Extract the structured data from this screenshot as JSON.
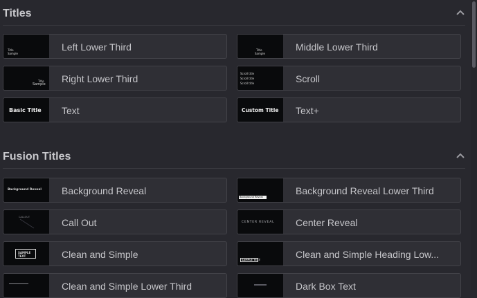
{
  "sections": [
    {
      "title": "Titles",
      "items": [
        {
          "label": "Left Lower Third",
          "thumb": [
            "Title",
            "Sample"
          ]
        },
        {
          "label": "Middle Lower Third",
          "thumb": [
            "Title",
            "Sample"
          ]
        },
        {
          "label": "Right Lower Third",
          "thumb": [
            "Title",
            "Sample"
          ]
        },
        {
          "label": "Scroll",
          "thumb": [
            "Scroll title",
            "Scroll title",
            "Scroll title"
          ]
        },
        {
          "label": "Text",
          "thumb": [
            "Basic Title"
          ]
        },
        {
          "label": "Text+",
          "thumb": [
            "Custom Title"
          ]
        }
      ]
    },
    {
      "title": "Fusion Titles",
      "items": [
        {
          "label": "Background Reveal",
          "thumb": [
            "Background Reveal"
          ]
        },
        {
          "label": "Background Reveal Lower Third",
          "thumb": [
            "Background Reveal"
          ]
        },
        {
          "label": "Call Out",
          "thumb": [
            "CALLOUT"
          ]
        },
        {
          "label": "Center Reveal",
          "thumb": [
            "CENTER REVEAL"
          ]
        },
        {
          "label": "Clean and Simple",
          "thumb": [
            "SAMPLE",
            "TEXT"
          ]
        },
        {
          "label": "Clean and Simple Heading Low...",
          "thumb": [
            "SAMPLE TEXT"
          ]
        },
        {
          "label": "Clean and Simple Lower Third",
          "thumb": []
        },
        {
          "label": "Dark Box Text",
          "thumb": []
        }
      ]
    }
  ]
}
